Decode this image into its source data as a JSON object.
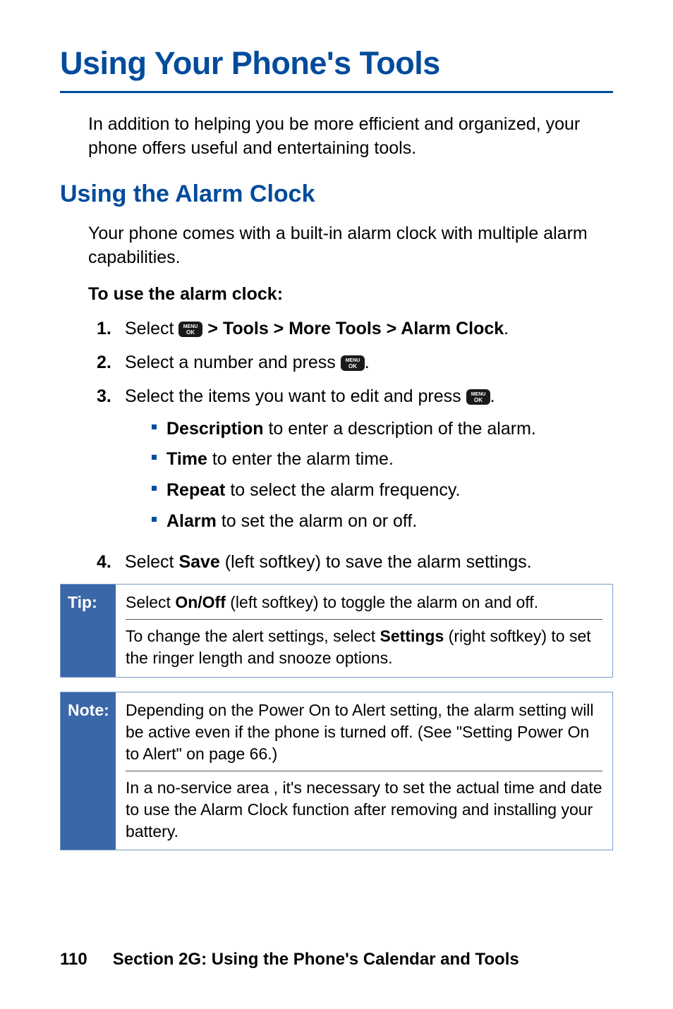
{
  "page": {
    "title": "Using Your Phone's Tools",
    "intro": "In addition to helping you be more efficient and organized, your phone offers useful and entertaining tools.",
    "subheading": "Using the Alarm Clock",
    "subintro": "Your phone comes with a built-in alarm clock with multiple alarm capabilities.",
    "task_heading": "To use the alarm clock:",
    "steps": [
      {
        "num": "1.",
        "prefix": "Select ",
        "path": " > Tools > More Tools > Alarm Clock",
        "suffix": "."
      },
      {
        "num": "2.",
        "prefix": "Select a number and press ",
        "suffix": "."
      },
      {
        "num": "3.",
        "prefix": "Select the items you want to edit and press ",
        "suffix": ".",
        "bullets": [
          {
            "bold": "Description",
            "rest": " to enter a description of the alarm."
          },
          {
            "bold": "Time",
            "rest": " to enter the alarm time."
          },
          {
            "bold": "Repeat",
            "rest": " to select the alarm frequency."
          },
          {
            "bold": "Alarm",
            "rest": " to set the alarm on or off."
          }
        ]
      },
      {
        "num": "4.",
        "prefix": "Select ",
        "bold_word": "Save",
        "suffix": " (left softkey) to save the alarm settings."
      }
    ],
    "tip": {
      "label": "Tip:",
      "p1_a": "Select ",
      "p1_bold": "On/Off",
      "p1_b": " (left softkey) to toggle the alarm on and off.",
      "p2_a": "To change the alert settings, select ",
      "p2_bold": "Settings",
      "p2_b": " (right softkey) to set the ringer length and snooze options."
    },
    "note": {
      "label": "Note:",
      "p1": "Depending on the Power On to Alert setting, the alarm setting will be active even if the phone is turned off. (See \"Setting Power On to Alert\" on page 66.)",
      "p2": "In a no-service area , it's necessary to set the actual time and date to use the Alarm Clock function after removing and installing your battery."
    },
    "footer": {
      "page_number": "110",
      "section": "Section 2G: Using the Phone's Calendar and Tools"
    },
    "icon_label": "MENU OK"
  }
}
